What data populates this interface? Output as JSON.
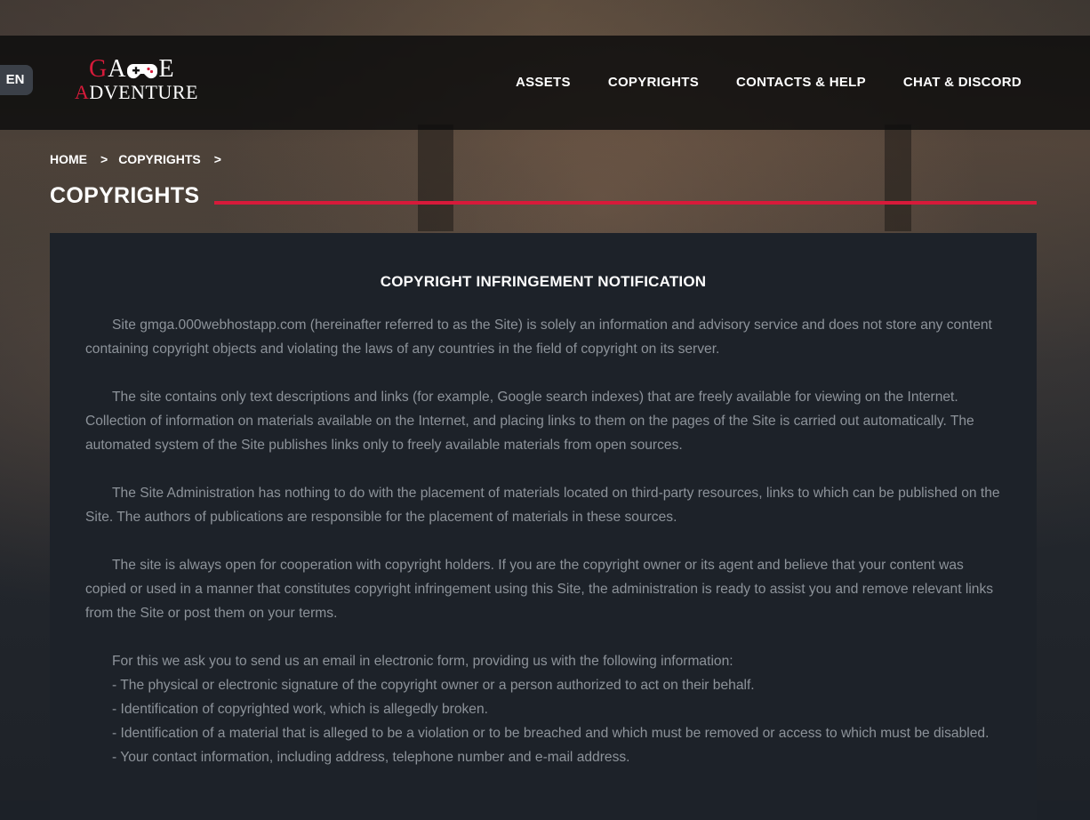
{
  "header": {
    "lang": "EN",
    "logo_line1": "GAME",
    "logo_line2": "ADVENTURE",
    "nav": [
      "ASSETS",
      "COPYRIGHTS",
      "CONTACTS & HELP",
      "CHAT & DISCORD"
    ]
  },
  "breadcrumb": {
    "home": "HOME",
    "sep": ">",
    "current": "COPYRIGHTS"
  },
  "page_title": "COPYRIGHTS",
  "notice": {
    "heading": "COPYRIGHT INFRINGEMENT NOTIFICATION",
    "paragraphs": [
      "Site gmga.000webhostapp.com (hereinafter referred to as the Site) is solely an information and advisory service and does not store any content containing copyright objects and violating the laws of any countries in the field of copyright on its server.",
      "The site contains only text descriptions and links (for example, Google search indexes) that are freely available for viewing on the Internet. Collection of information on materials available on the Internet, and placing links to them on the pages of the Site is carried out automatically. The automated system of the Site publishes links only to freely available materials from open sources.",
      "The Site Administration has nothing to do with the placement of materials located on third-party resources, links to which can be published on the Site. The authors of publications are responsible for the placement of materials in these sources.",
      "The site is always open for cooperation with copyright holders. If you are the copyright owner or its agent and believe that your content was copied or used in a manner that constitutes copyright infringement using this Site, the administration is ready to assist you and remove relevant links from the Site or post them on your terms."
    ],
    "request_intro": "For this we ask you to send us an email in electronic form, providing us with the following information:",
    "request_items": [
      "- The physical or electronic signature of the copyright owner or a person authorized to act on their behalf.",
      "- Identification of copyrighted work, which is allegedly broken.",
      "- Identification of a material that is alleged to be a violation or to be breached and which must be removed or access to which must be disabled.",
      "- Your contact information, including address, telephone number and e-mail address."
    ]
  }
}
